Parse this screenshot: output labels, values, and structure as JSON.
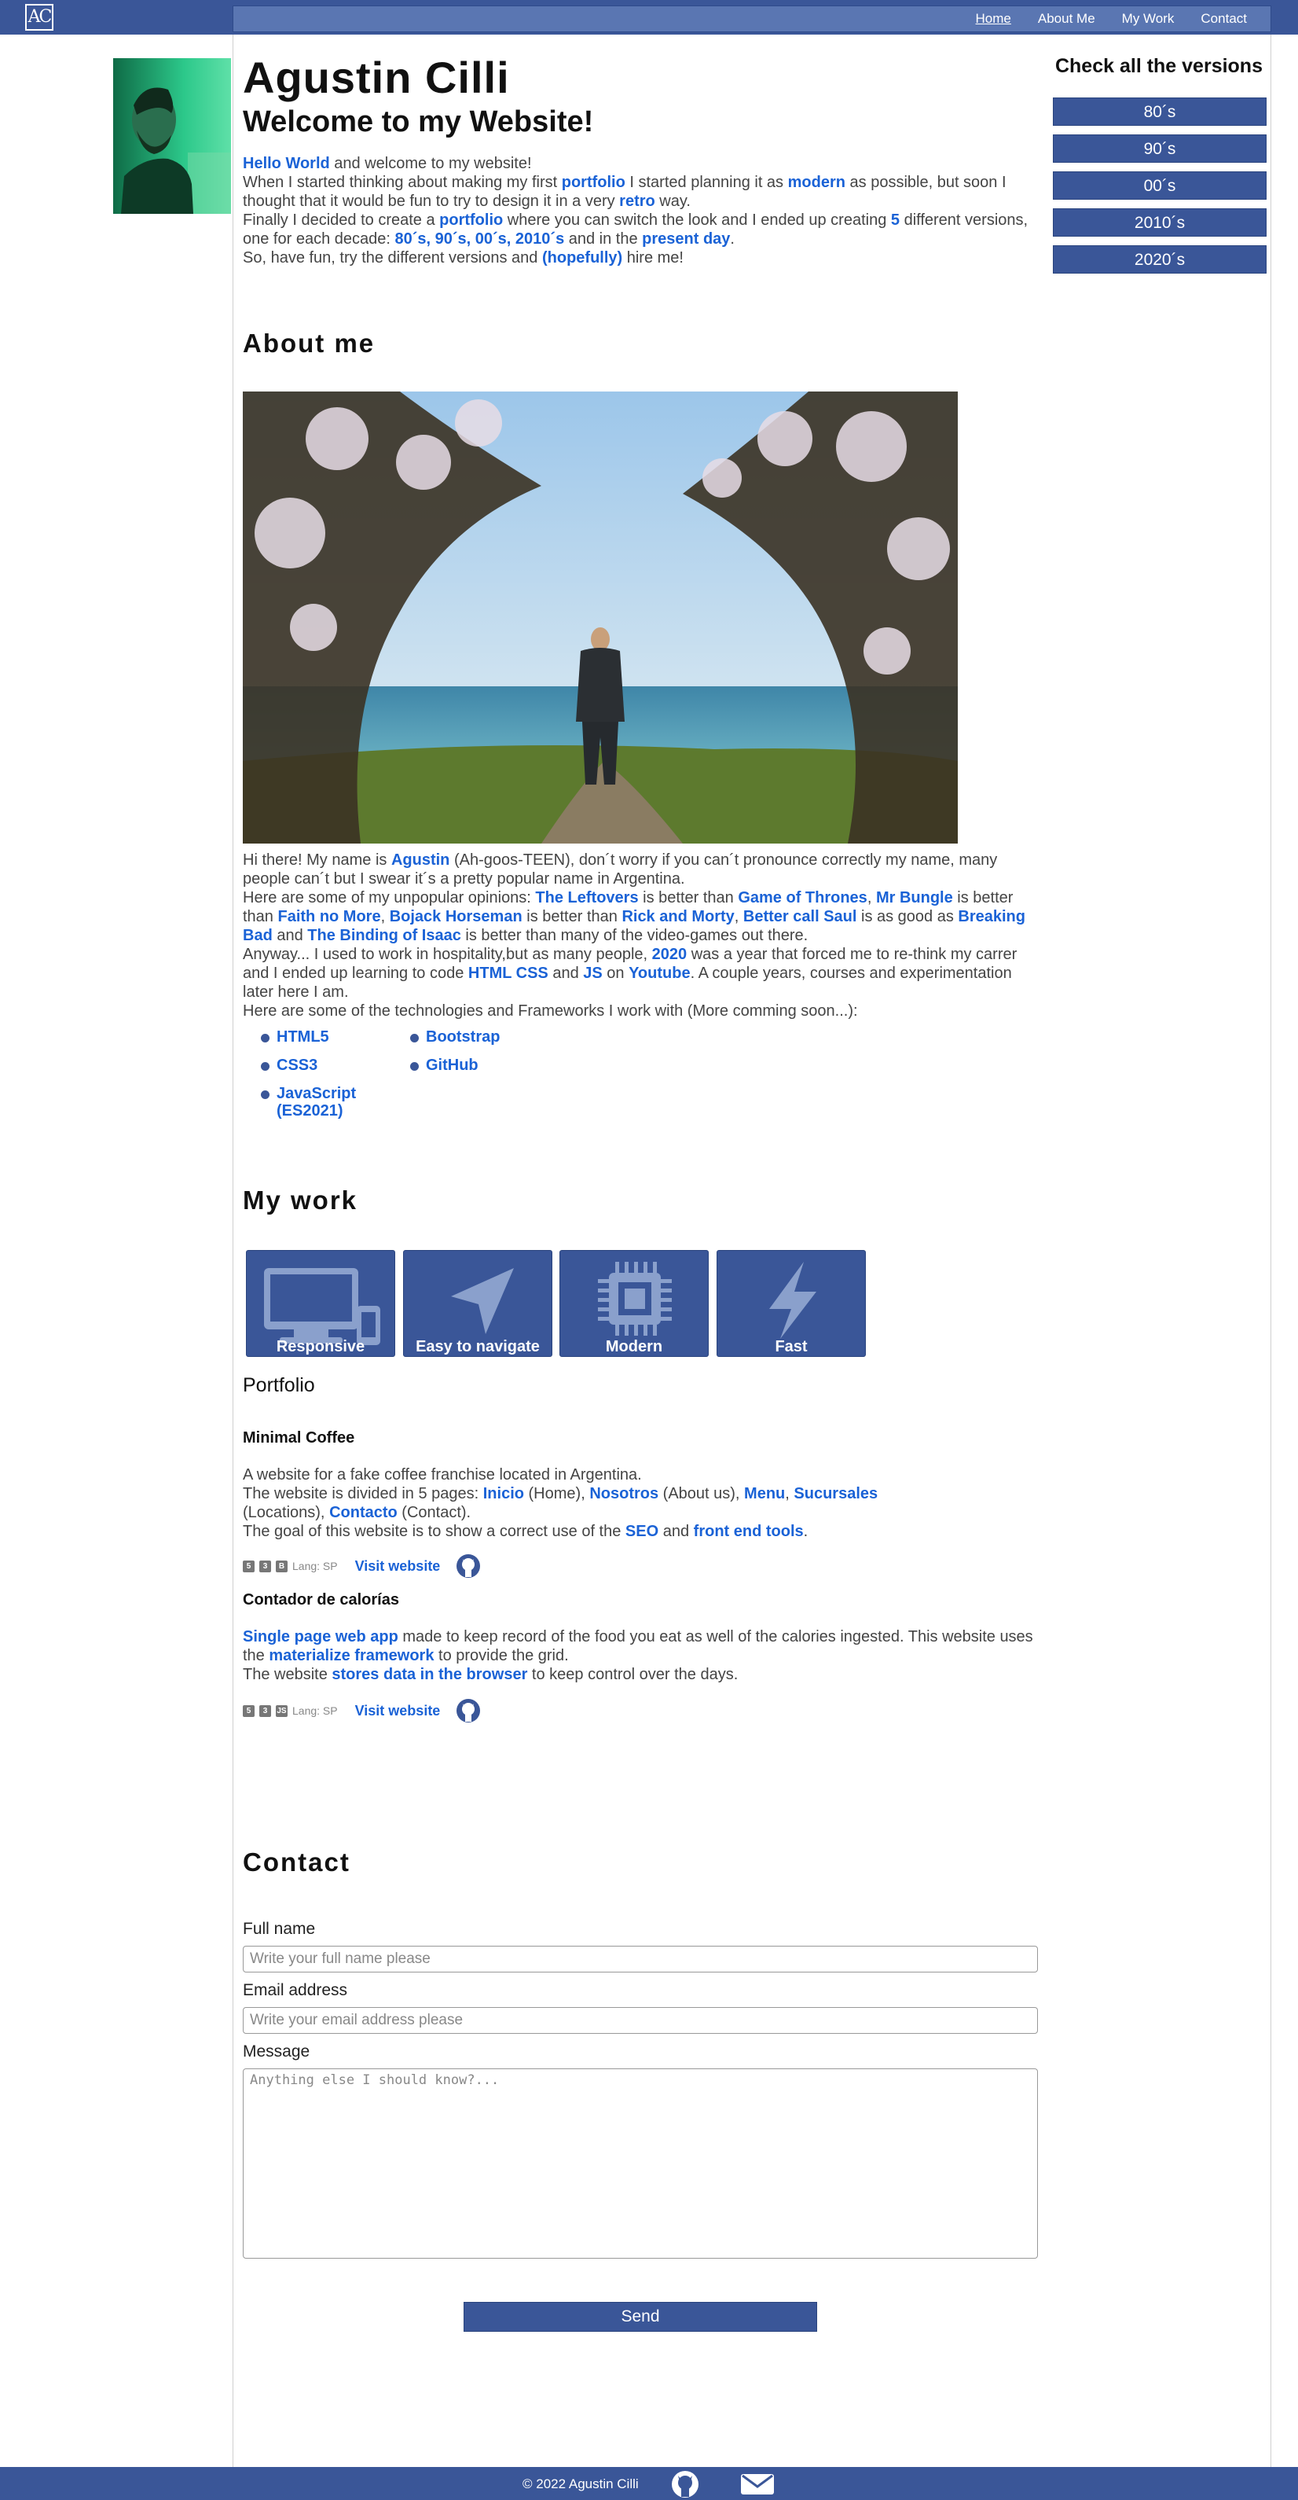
{
  "nav": {
    "logo_text": "AC",
    "links": [
      "Home",
      "About Me",
      "My Work",
      "Contact"
    ]
  },
  "hero": {
    "name": "Agustin Cilli",
    "subtitle": "Welcome to my Website!",
    "p1_hl": "Hello World",
    "p1_rest": " and welcome to my website!",
    "p2_a": "When I started thinking about making my first ",
    "p2_portfolio": "portfolio",
    "p2_b": " I started planning it as ",
    "p2_modern": "modern",
    "p2_c": " as possible, but soon I thought that it would be fun to try to design it in a very ",
    "p2_retro": "retro",
    "p2_d": " way.",
    "p3_a": "Finally I decided to create a ",
    "p3_portfolio": "portfolio",
    "p3_b": " where you can switch the look and I ended up creating ",
    "p3_five": "5",
    "p3_c": " different versions, one for each decade: ",
    "p3_decades": "80´s, 90´s, 00´s, 2010´s",
    "p3_d": " and in the ",
    "p3_present": "present day",
    "p3_e": ".",
    "p4_a": "So, have fun, try the different versions and ",
    "p4_hl": "(hopefully)",
    "p4_b": " hire me!"
  },
  "versions": {
    "title": "Check all the versions",
    "items": [
      "80´s",
      "90´s",
      "00´s",
      "2010´s",
      "2020´s"
    ]
  },
  "about": {
    "title": "About me",
    "l1_a": "Hi there! My name is ",
    "l1_name": "Agustin",
    "l1_b": " (Ah-goos-TEEN), don´t worry if you can´t pronounce correctly my name, many people can´t but I swear it´s a pretty popular name in Argentina.",
    "l2_a": "Here are some of my unpopular opinions: ",
    "op1": "The Leftovers",
    "t1": " is better than ",
    "op2": "Game of Thrones",
    "t2": ", ",
    "op3": "Mr Bungle",
    "t3": " is better than ",
    "op4": "Faith no More",
    "t4": ", ",
    "op5": "Bojack Horseman",
    "t5": " is better than ",
    "op6": "Rick and Morty",
    "t6": ", ",
    "op7": "Better call Saul",
    "t7": " is as good as ",
    "op8": "Breaking Bad",
    "t8": " and ",
    "op9": "The Binding of Isaac",
    "t9": " is better than many of the video-games out there.",
    "l3_a": "Anyway... I used to work in hospitality,but as many people, ",
    "l3_year": "2020",
    "l3_b": " was a year that forced me to re-think my carrer and I ended up learning to code ",
    "l3_htmlcss": "HTML CSS",
    "l3_c": " and ",
    "l3_js": "JS",
    "l3_d": " on ",
    "l3_yt": "Youtube",
    "l3_e": ". A couple years, courses and experimentation later here I am.",
    "l4": "Here are some of the technologies and Frameworks I work with (More comming soon...):",
    "tech": [
      "HTML5",
      "CSS3",
      "JavaScript (ES2021)",
      "Bootstrap",
      "GitHub"
    ]
  },
  "work": {
    "title": "My work",
    "features": [
      "Responsive",
      "Easy to navigate",
      "Modern",
      "Fast"
    ],
    "portfolio_title": "Portfolio",
    "lang": "Lang: SP",
    "visit": "Visit website",
    "p1": {
      "title": "Minimal Coffee",
      "l1": "A website for a fake coffee franchise located in Argentina.",
      "l2_a": "The website is divided in 5 pages: ",
      "pg1": "Inicio",
      "pg1_t": " (Home), ",
      "pg2": "Nosotros",
      "pg2_t": " (About us), ",
      "pg3": "Menu",
      "pg3_t": ", ",
      "pg4": "Sucursales",
      "pg4_t": " (Locations), ",
      "pg5": "Contacto",
      "pg5_t": " (Contact).",
      "l3_a": "The goal of this website is to show a correct use of the ",
      "seo": "SEO",
      "l3_b": " and ",
      "fet": "front end tools",
      "l3_c": "."
    },
    "p2": {
      "title": "Contador de calorías",
      "spa": "Single page web app",
      "l1_a": " made to keep record of the food you eat as well of the calories ingested. This website uses the ",
      "mat": "materialize framework",
      "l1_b": " to provide the grid.",
      "l2_a": "The website ",
      "store": "stores data in the browser",
      "l2_b": " to keep control over the days."
    }
  },
  "contact": {
    "title": "Contact",
    "name_label": "Full name",
    "name_ph": "Write your full name please",
    "email_label": "Email address",
    "email_ph": "Write your email address please",
    "msg_label": "Message",
    "msg_ph": "Anything else I should know?...",
    "send": "Send"
  },
  "footer": {
    "copyright": "© 2022 Agustin Cilli"
  },
  "colors": {
    "brand": "#3a5698",
    "link": "#1a62d6"
  }
}
